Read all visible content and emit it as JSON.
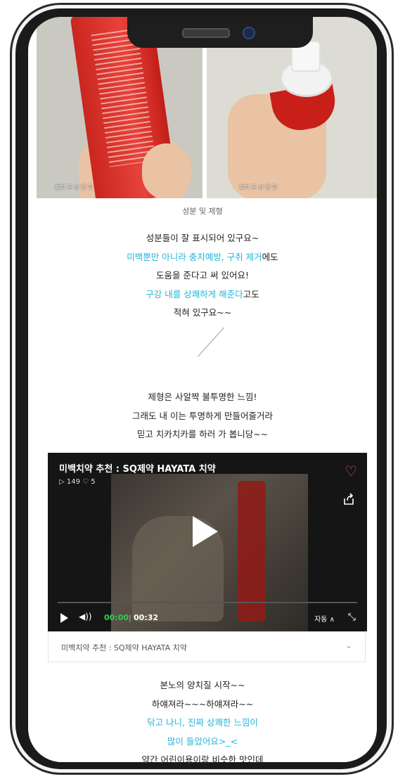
{
  "photos": {
    "left_label": "포닥 주 선 한 듯",
    "right_label": "포닥 주 선 한 듯",
    "caption": "성분 및 제형"
  },
  "para1": {
    "line1": "성분들이 잘 표시되어 있구요~",
    "line2_hl": "미백뿐만 아니라 충치예방, 구취 제거",
    "line2_rest": "에도",
    "line3": "도움을 준다고 써 있어요!",
    "line4_hl": "구강 내를 상쾌하게 해준다",
    "line4_rest": "고도",
    "line5": "적혀 있구요~~"
  },
  "para2": {
    "line1": "제형은 사알짝 불투명한 느낌!",
    "line2": "그래도 내 이는 투명하게 만들어줄거라",
    "line3": "믿고 치카치카를 하러 가 봅니당~~"
  },
  "video": {
    "title": "미백치약 추천 : SQ제약 HAYATA 치약",
    "stats": "▷ 149  ♡ 5",
    "time_current": "00:00",
    "time_sep": "|",
    "time_total": "00:32",
    "quality": "자동 ∧",
    "bar_title": "미백치약 추천 : SQ제약 HAYATA 치약"
  },
  "para3": {
    "line1": "본노의 양치질 시작~~",
    "line2": "하얘져라~~~하얘져라~~",
    "line3_hl": "닦고 나니, 진짜 상쾌한 느낌이",
    "line4_hl": "많이 들었어요>_<",
    "line5": "약간 어린이용이랑 비슷한 맛인데"
  },
  "colors": {
    "highlight": "#1fb6d9",
    "heart": "#e64a4a",
    "time": "#29d04a"
  }
}
